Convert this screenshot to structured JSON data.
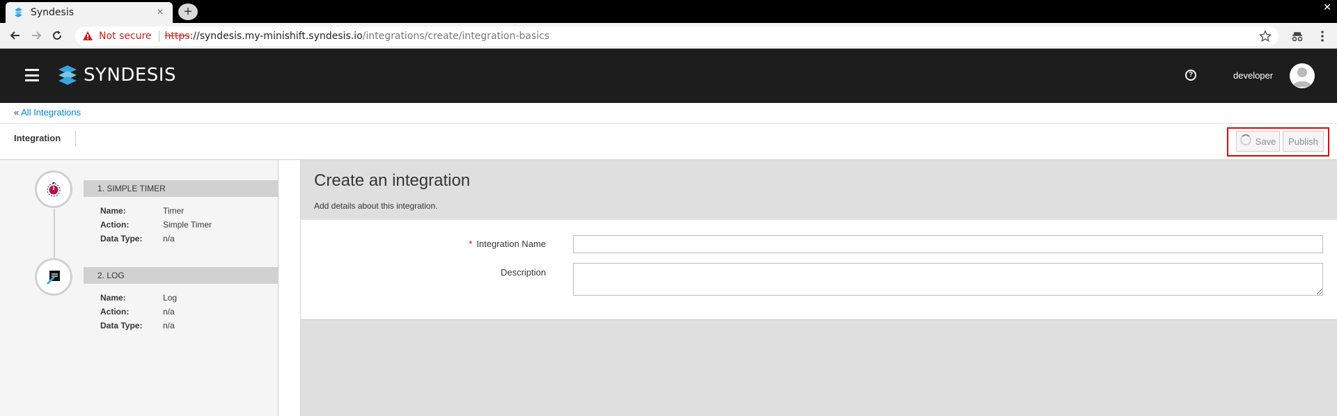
{
  "browser": {
    "tab_title": "Syndesis",
    "tab_close": "×",
    "new_tab": "+",
    "window_close": "✕",
    "not_secure": "Not secure",
    "url_scheme": "https",
    "url_host": "://syndesis.my-minishift.syndesis.io",
    "url_path": "/integrations/create/integration-basics"
  },
  "header": {
    "brand": "SYNDESIS",
    "help": "?",
    "username": "developer"
  },
  "breadcrumb": {
    "prefix": "«",
    "link": "All Integrations"
  },
  "toolbar": {
    "title": "Integration",
    "save_label": "Save",
    "publish_label": "Publish"
  },
  "steps": [
    {
      "heading": "1. SIMPLE TIMER",
      "icon": "timer-icon",
      "props": [
        {
          "key": "Name:",
          "value": "Timer"
        },
        {
          "key": "Action:",
          "value": "Simple Timer"
        },
        {
          "key": "Data Type:",
          "value": "n/a"
        }
      ]
    },
    {
      "heading": "2. LOG",
      "icon": "log-icon",
      "props": [
        {
          "key": "Name:",
          "value": "Log"
        },
        {
          "key": "Action:",
          "value": "n/a"
        },
        {
          "key": "Data Type:",
          "value": "n/a"
        }
      ]
    }
  ],
  "main": {
    "title": "Create an integration",
    "subtitle": "Add details about this integration.",
    "name_required": "*",
    "name_label": "Integration Name",
    "name_value": "",
    "description_label": "Description",
    "description_value": ""
  },
  "colors": {
    "header_bg": "#1d1d1d",
    "link": "#0088ce",
    "highlight": "#e00000",
    "required": "#cc0000"
  }
}
